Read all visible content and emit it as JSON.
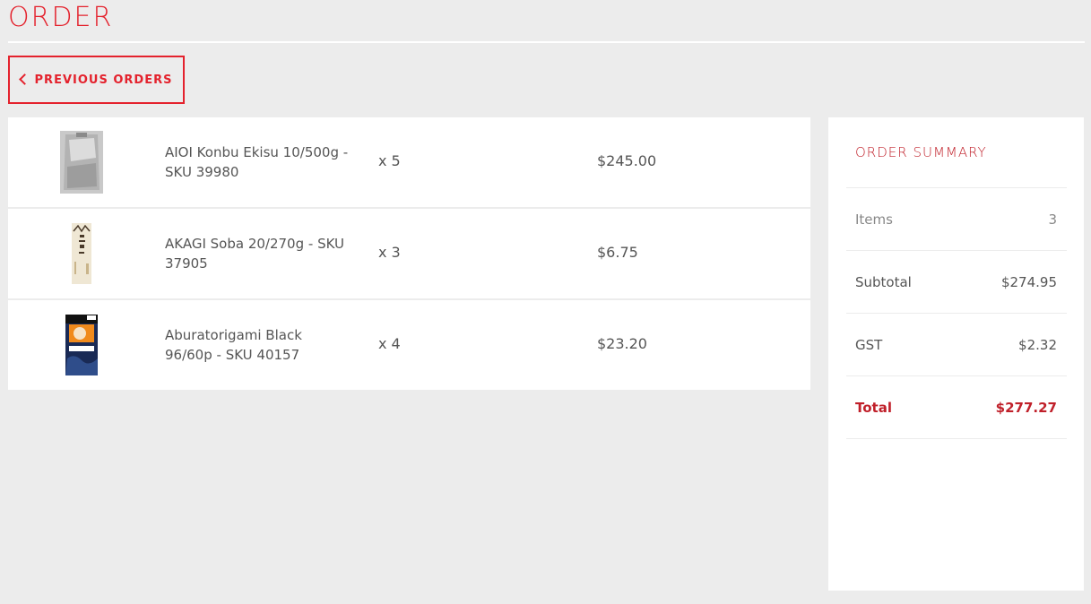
{
  "page": {
    "title": "ORDER"
  },
  "back_button": {
    "label": "PREVIOUS ORDERS",
    "icon": "chevron-left-icon"
  },
  "items": [
    {
      "name": "AIOI Konbu Ekisu 10/500g - SKU 39980",
      "qty": "x 5",
      "price": "$245.00",
      "image_colors": {
        "main": "#b7b7b7",
        "accent": "#8a8a8a"
      }
    },
    {
      "name": "AKAGI Soba 20/270g - SKU 37905",
      "qty": "x 3",
      "price": "$6.75",
      "image_colors": {
        "main": "#efe7d4",
        "accent": "#4a3a2a"
      }
    },
    {
      "name": "Aburatorigami Black 96/60p - SKU 40157",
      "qty": "x 4",
      "price": "$23.20",
      "image_colors": {
        "main": "#1a2a55",
        "accent": "#f08a1c"
      }
    }
  ],
  "summary": {
    "title": "ORDER SUMMARY",
    "rows": [
      {
        "label": "Items",
        "value": "3"
      },
      {
        "label": "Subtotal",
        "value": "$274.95"
      },
      {
        "label": "GST",
        "value": "$2.32"
      },
      {
        "label": "Total",
        "value": "$277.27"
      }
    ]
  },
  "colors": {
    "accent": "#e4222d",
    "accent_dark": "#c0202a",
    "background": "#ececec",
    "card": "#ffffff"
  }
}
